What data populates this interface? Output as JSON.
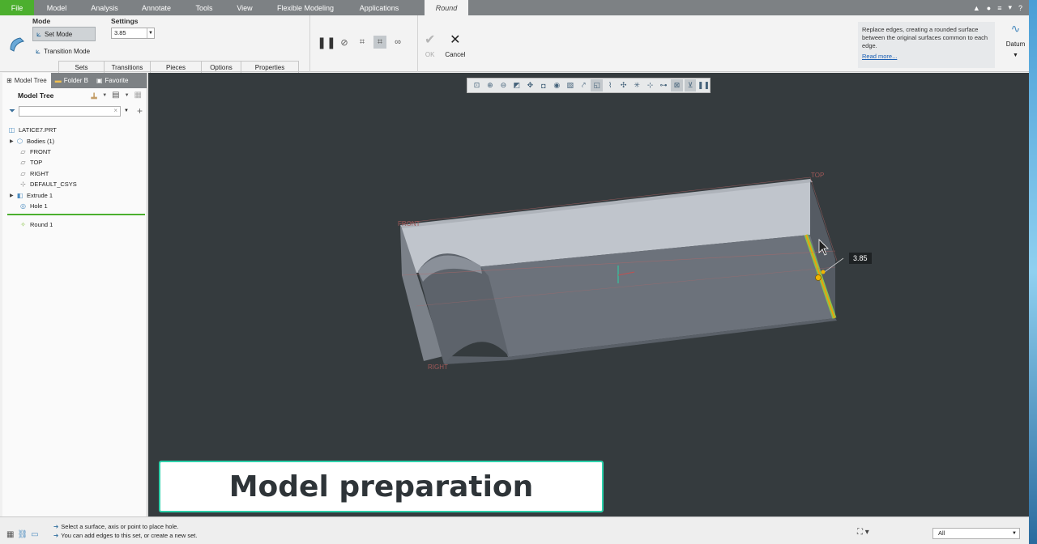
{
  "menubar": {
    "items": [
      "File",
      "Model",
      "Analysis",
      "Annotate",
      "Tools",
      "View",
      "Flexible Modeling",
      "Applications",
      "Round"
    ]
  },
  "ribbon": {
    "mode_label": "Mode",
    "set_mode": "Set Mode",
    "transition_mode": "Transition Mode",
    "settings_label": "Settings",
    "radius_value": "3.85",
    "tabs": [
      "Sets",
      "Transitions",
      "Pieces",
      "Options",
      "Properties"
    ],
    "ok": "OK",
    "cancel": "Cancel",
    "help_text": "Replace edges, creating a rounded surface between the original surfaces common to each edge.",
    "read_more": "Read more...",
    "datum": "Datum"
  },
  "panel": {
    "tabs": [
      "Model Tree",
      "Folder B",
      "Favorite"
    ],
    "tree_title": "Model Tree",
    "nodes": [
      {
        "label": "LATICE7.PRT",
        "icon": "part-icon",
        "expand": false
      },
      {
        "label": "Bodies (1)",
        "icon": "bodies-icon",
        "expand": true
      },
      {
        "label": "FRONT",
        "icon": "datum-plane-icon",
        "expand": false
      },
      {
        "label": "TOP",
        "icon": "datum-plane-icon",
        "expand": false
      },
      {
        "label": "RIGHT",
        "icon": "datum-plane-icon",
        "expand": false
      },
      {
        "label": "DEFAULT_CSYS",
        "icon": "csys-icon",
        "expand": false
      },
      {
        "label": "Extrude 1",
        "icon": "extrude-icon",
        "expand": true
      },
      {
        "label": "Hole 1",
        "icon": "hole-icon",
        "expand": false
      },
      {
        "label": "Round 1",
        "icon": "round-icon",
        "expand": false
      }
    ]
  },
  "viewport": {
    "plane_labels": [
      "TOP",
      "FRONT",
      "RIGHT"
    ],
    "dimension": "3.85"
  },
  "caption": "Model preparation",
  "status": {
    "line1": "Select a surface, axis or point to place hole.",
    "line2": "You can add edges to this set, or create a new set.",
    "selection_filter": "All"
  },
  "colors": {
    "accent_green": "#4caf2e",
    "caption_border": "#2cd1ab",
    "viewport_bg": "#353b3e",
    "menubar_bg": "#7d8184"
  }
}
